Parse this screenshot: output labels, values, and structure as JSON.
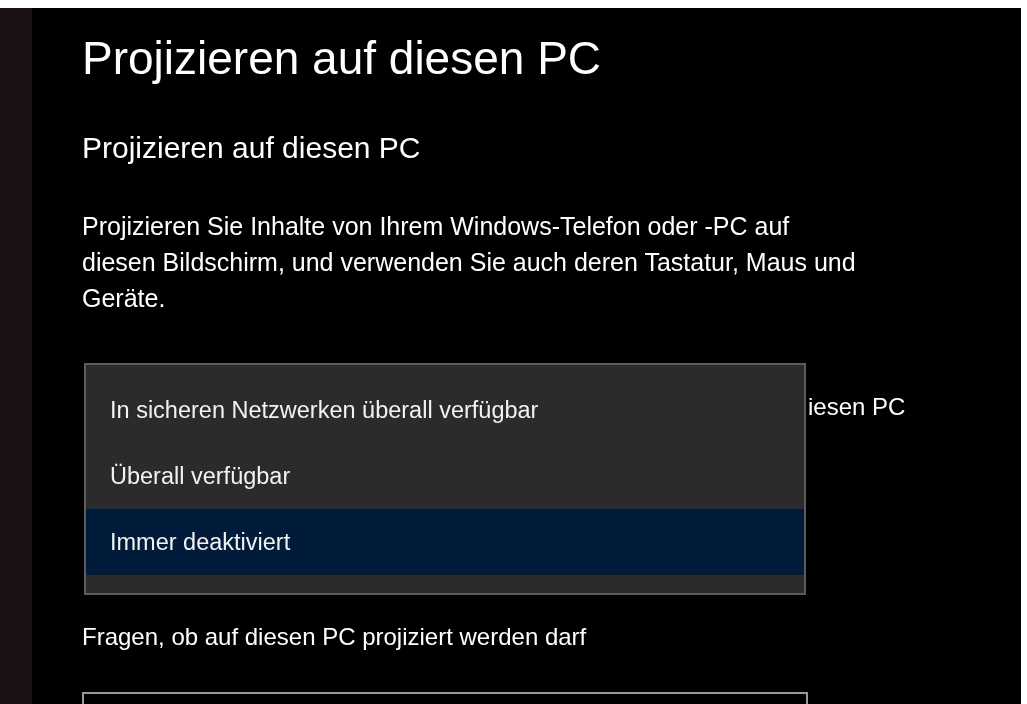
{
  "page": {
    "title": "Projizieren auf diesen PC"
  },
  "section": {
    "heading": "Projizieren auf diesen PC",
    "description": "Projizieren Sie Inhalte von Ihrem Windows-Telefon oder -PC auf diesen Bildschirm, und verwenden Sie auch deren Tastatur, Maus und Geräte."
  },
  "covered_label": "iesen PC",
  "dropdown_menu": {
    "options": [
      {
        "label": "In sicheren Netzwerken überall verfügbar",
        "selected": false
      },
      {
        "label": "Überall verfügbar",
        "selected": false
      },
      {
        "label": "Immer deaktiviert",
        "selected": true
      }
    ]
  },
  "ask_label": "Fragen, ob auf diesen PC projiziert werden darf"
}
